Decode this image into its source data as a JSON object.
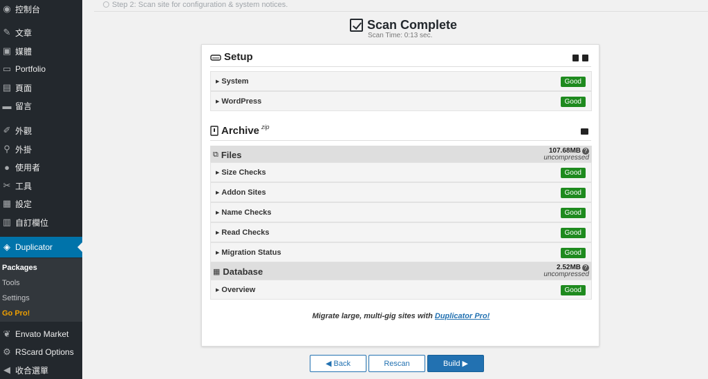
{
  "sidebar": {
    "items": [
      {
        "label": "控制台",
        "icon": "dashboard-icon",
        "glyph": "◉"
      },
      {
        "label": "文章",
        "icon": "pin-icon",
        "glyph": "✎"
      },
      {
        "label": "媒體",
        "icon": "media-icon",
        "glyph": "▣"
      },
      {
        "label": "Portfolio",
        "icon": "portfolio-icon",
        "glyph": "▭"
      },
      {
        "label": "頁面",
        "icon": "page-icon",
        "glyph": "▤"
      },
      {
        "label": "留言",
        "icon": "comment-icon",
        "glyph": "▬"
      },
      {
        "label": "外觀",
        "icon": "brush-icon",
        "glyph": "✐"
      },
      {
        "label": "外掛",
        "icon": "plugin-icon",
        "glyph": "⚲"
      },
      {
        "label": "使用者",
        "icon": "user-icon",
        "glyph": "●"
      },
      {
        "label": "工具",
        "icon": "wrench-icon",
        "glyph": "✂"
      },
      {
        "label": "設定",
        "icon": "settings-icon",
        "glyph": "▦"
      },
      {
        "label": "自訂欄位",
        "icon": "fields-icon",
        "glyph": "▥"
      },
      {
        "label": "Duplicator",
        "icon": "duplicator-icon",
        "glyph": "◈"
      },
      {
        "label": "Envato Market",
        "icon": "leaf-icon",
        "glyph": "❦"
      },
      {
        "label": "RScard Options",
        "icon": "gear-icon",
        "glyph": "⚙"
      },
      {
        "label": "收合選單",
        "icon": "collapse-icon",
        "glyph": "◀"
      }
    ],
    "submenu": [
      "Packages",
      "Tools",
      "Settings",
      "Go Pro!"
    ]
  },
  "step_text": "Step 2: Scan site for configuration & system notices.",
  "header": {
    "title": "Scan Complete",
    "scan_time": "Scan Time: 0:13 sec."
  },
  "setup": {
    "title": "Setup",
    "rows": [
      {
        "label": "System",
        "status": "Good"
      },
      {
        "label": "WordPress",
        "status": "Good"
      }
    ]
  },
  "archive": {
    "title": "Archive",
    "sup": "zip",
    "files": {
      "title": "Files",
      "size": "107.68MB",
      "size_note": "uncompressed",
      "rows": [
        {
          "label": "Size Checks",
          "status": "Good"
        },
        {
          "label": "Addon Sites",
          "status": "Good"
        },
        {
          "label": "Name Checks",
          "status": "Good"
        },
        {
          "label": "Read Checks",
          "status": "Good"
        },
        {
          "label": "Migration Status",
          "status": "Good"
        }
      ]
    },
    "database": {
      "title": "Database",
      "size": "2.52MB",
      "size_note": "uncompressed",
      "rows": [
        {
          "label": "Overview",
          "status": "Good"
        }
      ]
    }
  },
  "promo": {
    "text": "Migrate large, multi-gig sites with ",
    "link": "Duplicator Pro!"
  },
  "buttons": {
    "back": "◀ Back",
    "rescan": "Rescan",
    "build": "Build ▶"
  },
  "colors": {
    "accent": "#2271b1",
    "good": "#1e8a1e",
    "sidebar": "#23282d",
    "active": "#0073aa"
  }
}
